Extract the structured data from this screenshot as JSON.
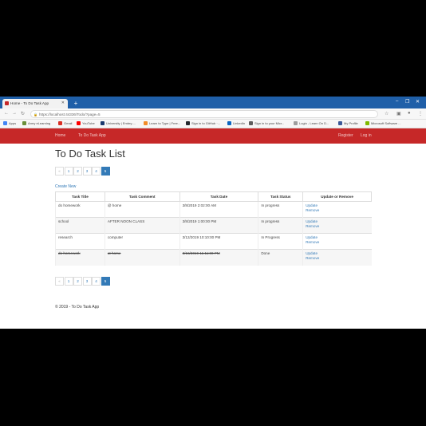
{
  "browser": {
    "tab_title": "Home - To Do Task App",
    "url": "https://localhost:44336/Todo/?page=5",
    "bookmarks": [
      {
        "label": "Apps",
        "color": "#4285f4"
      },
      {
        "label": "Army eLearning",
        "color": "#6a8f3a"
      },
      {
        "label": "Gmail",
        "color": "#d93025"
      },
      {
        "label": "YouTube",
        "color": "#ff0000"
      },
      {
        "label": "University | Embry-...",
        "color": "#1a3a6e"
      },
      {
        "label": "Learn to Type | Free...",
        "color": "#f28c28"
      },
      {
        "label": "Sign in to GitHub ·...",
        "color": "#24292e"
      },
      {
        "label": "LinkedIn",
        "color": "#0a66c2"
      },
      {
        "label": "Sign in to your Micr...",
        "color": "#5e5e5e"
      },
      {
        "label": "Login - Learn On D...",
        "color": "#9e9e9e"
      },
      {
        "label": "My Profile",
        "color": "#3b5998"
      },
      {
        "label": "Microsoft Software ...",
        "color": "#7fba00"
      }
    ]
  },
  "navbar": {
    "brand": "Home",
    "app_link": "To Do Task App",
    "register": "Register",
    "login": "Log in",
    "color": "#c62828"
  },
  "page": {
    "title": "To Do Task List",
    "create_new": "Create New",
    "pager": [
      "«",
      "1",
      "2",
      "3",
      "4",
      "5"
    ],
    "active_page": "5"
  },
  "table": {
    "headers": [
      "Task Title",
      "Task Comment",
      "Task Date",
      "Task Status",
      "Update or Remove"
    ],
    "rows": [
      {
        "title": "do homework",
        "comment": "@ home",
        "date": "3/8/2019 2:02:00 AM",
        "status": "In progress",
        "update": "Update",
        "remove": "Remove"
      },
      {
        "title": "school",
        "comment": "AFTER NOON CLASS",
        "date": "3/8/2019 1:00:00 PM",
        "status": "In progress",
        "update": "Update",
        "remove": "Remove"
      },
      {
        "title": "research",
        "comment": "computer",
        "date": "3/12/2019 10:10:00 PM",
        "status": "In Progress",
        "update": "Update",
        "remove": "Remove"
      },
      {
        "title": "do homework",
        "comment": "at home",
        "date": "3/18/2019 11:11:00 PM",
        "status": "Done",
        "update": "Update",
        "remove": "Remove"
      }
    ]
  },
  "footer": {
    "text": "© 2019 - To Do Task App"
  }
}
